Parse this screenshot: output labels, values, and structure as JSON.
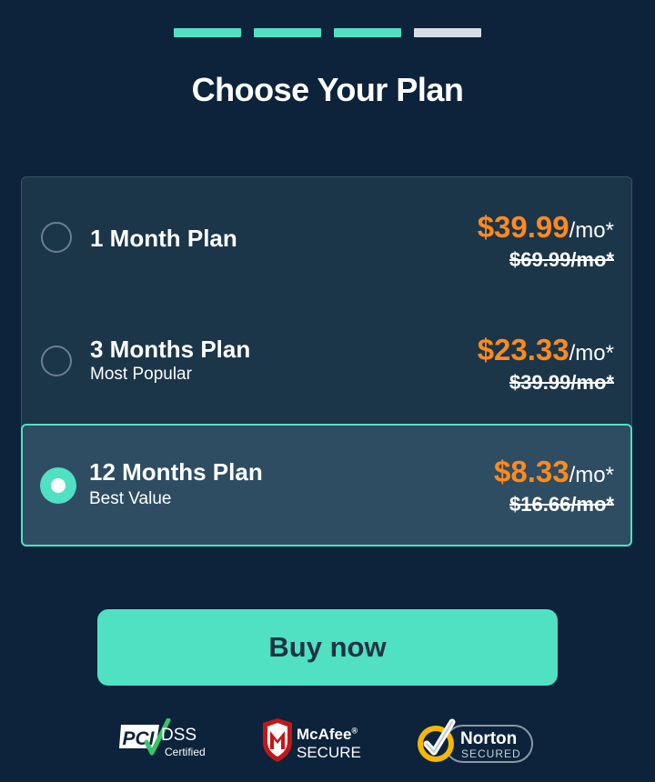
{
  "progress": {
    "total_steps": 4,
    "completed_steps": 3,
    "active_color": "#4fe1c2",
    "inactive_color": "#d6dde4"
  },
  "title": "Choose Your Plan",
  "plans": [
    {
      "name": "1 Month Plan",
      "subtitle": "",
      "price": "$39.99",
      "unit": "/mo*",
      "old_price": "$69.99/mo*",
      "selected": false
    },
    {
      "name": "3 Months Plan",
      "subtitle": "Most Popular",
      "price": "$23.33",
      "unit": "/mo*",
      "old_price": "$39.99/mo*",
      "selected": false
    },
    {
      "name": "12 Months Plan",
      "subtitle": "Best Value",
      "price": "$8.33",
      "unit": "/mo*",
      "old_price": "$16.66/mo*",
      "selected": true
    }
  ],
  "buy_button": "Buy now",
  "badges": {
    "pci": {
      "logo": "PCI",
      "line1": "DSS",
      "line2": "Certified"
    },
    "mcafee": {
      "name": "McAfee",
      "reg": "®",
      "label": "SECURE"
    },
    "norton": {
      "name": "Norton",
      "label": "SECURED"
    }
  },
  "colors": {
    "background": "#0c233b",
    "accent": "#4fe1c2",
    "price": "#ff8a1e",
    "panel": "#1b3549",
    "selected_panel": "#2e4d62"
  }
}
